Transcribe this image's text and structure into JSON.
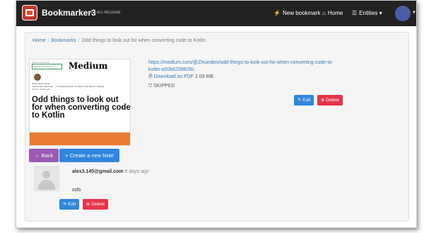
{
  "navbar": {
    "brand": "Bookmarker3",
    "version": "v1.5-ALL-RELEASE",
    "new_bookmark": "New bookmark",
    "home": "Home",
    "entities": "Entities",
    "icons": {
      "new_bookmark": "bolt-icon",
      "home": "home-icon",
      "entities": "list-icon",
      "caret": "caret-down-icon"
    }
  },
  "breadcrumb": {
    "home": "Home",
    "bookmarks": "Bookmarks",
    "current": "Odd things to look out for when converting code to Kotlin"
  },
  "thumbnail": {
    "header": "About membership",
    "sign": "Sign in    Get started",
    "publication": "Medium",
    "author": "Jaime Vesel  Follow",
    "meta": "Android dev.  ZhuInden ... or TypeAndroid @: 10  Tinkers with flowers ,Dialogs ...",
    "date": "Oct 14 · 6 min read",
    "title": "Odd things to look out for when converting code to Kotlin"
  },
  "bookmark": {
    "url": "https://medium.com/@Zhuinden/odd-things-to-look-out-for-when-converting-code-to-kotlin-a00b6239828c",
    "pdf_label": "Download as PDF",
    "pdf_size": "2.09 MB",
    "status": "SKIPPED",
    "edit": "Edit",
    "delete": "Delete"
  },
  "actions": {
    "back": "Back",
    "new_note": "Create a new Note"
  },
  "note": {
    "email": "alex3.145@gmail.com",
    "time": "6 days ago",
    "text": "ssfs",
    "edit": "Edit",
    "delete": "Delete"
  },
  "colors": {
    "navbar": "#222222",
    "link": "#337ab7",
    "edit": "#2e86de",
    "delete": "#e8344a",
    "back": "#9b59b6",
    "accent_bar": "#e87c30"
  }
}
